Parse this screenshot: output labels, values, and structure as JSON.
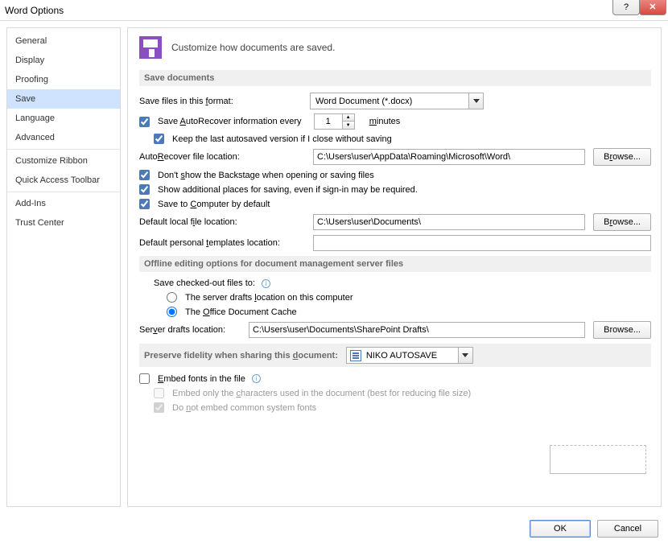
{
  "window": {
    "title": "Word Options"
  },
  "sidebar": {
    "items": [
      {
        "label": "General"
      },
      {
        "label": "Display"
      },
      {
        "label": "Proofing"
      },
      {
        "label": "Save",
        "selected": true
      },
      {
        "label": "Language"
      },
      {
        "label": "Advanced"
      },
      {
        "label": "Customize Ribbon",
        "sep": true
      },
      {
        "label": "Quick Access Toolbar"
      },
      {
        "label": "Add-Ins",
        "sep": true
      },
      {
        "label": "Trust Center"
      }
    ]
  },
  "header": {
    "text": "Customize how documents are saved."
  },
  "sec_save": {
    "title": "Save documents",
    "format_label_pre": "Save files in this ",
    "format_label_u": "f",
    "format_label_post": "ormat:",
    "format_value": "Word Document (*.docx)",
    "autorec_pre": "Save ",
    "autorec_u": "A",
    "autorec_post": "utoRecover information every",
    "minutes_u": "m",
    "minutes_post": "inutes",
    "autorec_value": "1",
    "keep_last": "Keep the last autosaved version if I close without saving",
    "autorec_loc_pre": "Auto",
    "autorec_loc_u": "R",
    "autorec_loc_post": "ecover file location:",
    "autorec_path": "C:\\Users\\user\\AppData\\Roaming\\Microsoft\\Word\\",
    "dont_show_pre": "Don't ",
    "dont_show_u": "s",
    "dont_show_post": "how the Backstage when opening or saving files",
    "show_add": "Show additional places for saving, even if sign-in may be required.",
    "save_comp_pre": "Save to ",
    "save_comp_u": "C",
    "save_comp_post": "omputer by default",
    "def_local_pre": "Default local f",
    "def_local_u": "i",
    "def_local_post": "le location:",
    "def_local_path": "C:\\Users\\user\\Documents\\",
    "def_tpl_pre": "Default personal ",
    "def_tpl_u": "t",
    "def_tpl_post": "emplates location:",
    "def_tpl_path": "",
    "browse_pre": "B",
    "browse_u": "r",
    "browse_post": "owse..."
  },
  "sec_offline": {
    "title": "Offline editing options for document management server files",
    "checked_out": "Save checked-out files to:",
    "opt1_pre": "The server drafts ",
    "opt1_u": "l",
    "opt1_post": "ocation on this computer",
    "opt2_pre": "The ",
    "opt2_u": "O",
    "opt2_post": "ffice Document Cache",
    "srv_pre": "Ser",
    "srv_u": "v",
    "srv_post": "er drafts location:",
    "srv_path": "C:\\Users\\user\\Documents\\SharePoint Drafts\\",
    "browse": "Browse..."
  },
  "sec_preserve": {
    "title_pre": "Preserve fidelity when sharing this ",
    "title_u": "d",
    "title_post": "ocument:",
    "doc_name": "NIKO AUTOSAVE",
    "embed_pre": "E",
    "embed_u": "",
    "embed_txt": "mbed fonts in the file",
    "embed_pref": "",
    "embed_u1": "E",
    "only_pre": "Embed only the ",
    "only_u": "c",
    "only_post": "haracters used in the document (best for reducing file size)",
    "donot_pre": "Do ",
    "donot_u": "n",
    "donot_post": "ot embed common system fonts"
  },
  "footer": {
    "ok": "OK",
    "cancel": "Cancel"
  }
}
